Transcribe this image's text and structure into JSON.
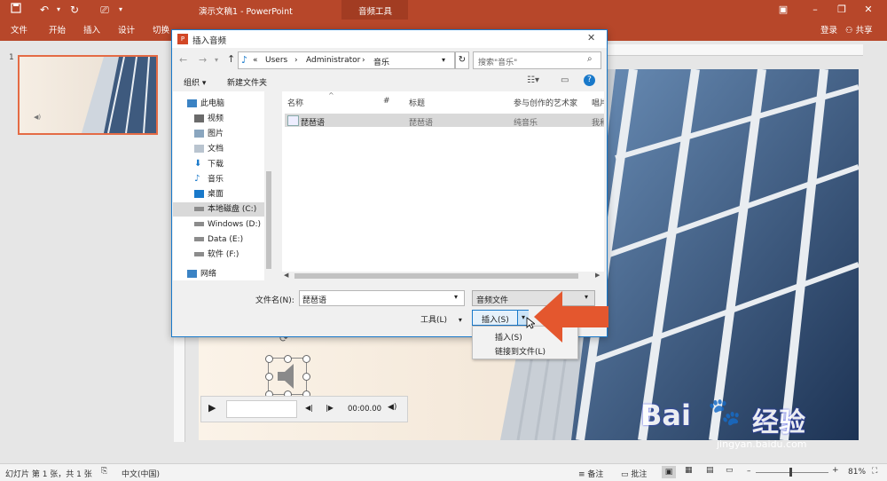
{
  "titlebar": {
    "document_title": "演示文稿1 - PowerPoint",
    "context_group": "音频工具"
  },
  "ribbon": {
    "tabs": [
      "文件",
      "开始",
      "插入",
      "设计",
      "切换"
    ],
    "signin": "登录",
    "share": "共享"
  },
  "slides_pane": {
    "slide_number": "1"
  },
  "dialog": {
    "title": "插入音频",
    "breadcrumb": [
      "«",
      "Users",
      "›",
      "Administrator",
      "›",
      "音乐"
    ],
    "search_placeholder": "搜索\"音乐\"",
    "organize": "组织 ▾",
    "new_folder": "新建文件夹",
    "nav_items": [
      {
        "label": "此电脑",
        "icon": "computer-icon"
      },
      {
        "label": "视频",
        "icon": "video-folder-icon"
      },
      {
        "label": "图片",
        "icon": "pictures-folder-icon"
      },
      {
        "label": "文档",
        "icon": "documents-folder-icon"
      },
      {
        "label": "下载",
        "icon": "download-icon"
      },
      {
        "label": "音乐",
        "icon": "music-note-icon"
      },
      {
        "label": "桌面",
        "icon": "desktop-icon"
      },
      {
        "label": "本地磁盘 (C:)",
        "icon": "drive-icon"
      },
      {
        "label": "Windows (D:)",
        "icon": "drive-icon"
      },
      {
        "label": "Data (E:)",
        "icon": "drive-icon"
      },
      {
        "label": "软件 (F:)",
        "icon": "drive-icon"
      },
      {
        "label": "网络",
        "icon": "network-icon"
      }
    ],
    "columns": [
      "名称",
      "#",
      "标题",
      "参与创作的艺术家",
      "唱片"
    ],
    "files": [
      {
        "name": "琵琶语",
        "title": "琵琶语",
        "artist": "纯音乐",
        "album": "我和"
      }
    ],
    "filename_label": "文件名(N):",
    "filename_value": "琵琶语",
    "filetype": "音频文件",
    "tools": "工具(L)",
    "insert_button": "插入(S)",
    "menu_items": [
      "插入(S)",
      "链接到文件(L)"
    ]
  },
  "media_player": {
    "time": "00:00.00"
  },
  "statusbar": {
    "slide_info": "幻灯片 第 1 张，共 1 张",
    "language": "中文(中国)",
    "notes": "备注",
    "comments": "批注",
    "zoom": "81%"
  },
  "watermark": {
    "brand": "Bai",
    "brand2": "经验",
    "url": "jingyan.baidu.com"
  },
  "colors": {
    "ribbon": "#b7472a",
    "accent_arrow": "#e4572e",
    "dialog_border": "#1979ca",
    "baidu_blue": "#2932e1"
  }
}
